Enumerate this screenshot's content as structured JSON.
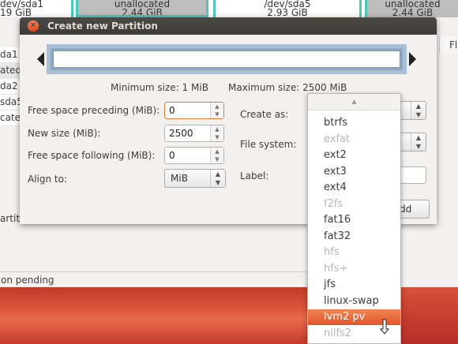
{
  "background_window": {
    "top_cells": [
      {
        "line1": "dev/sda1",
        "line2": "19 GiB"
      },
      {
        "line1": "unallocated",
        "line2": "2.44 GiB"
      },
      {
        "line1": "/dev/sda5",
        "line2": "2.93 GiB"
      },
      {
        "line1": "unallocated",
        "line2": "2.44 GiB"
      }
    ],
    "column_header": "Fl",
    "list_rows": [
      "da1",
      "ated",
      "da2",
      "sda5",
      "cate"
    ],
    "partitions_label": "artiti",
    "pending_status": "on pending"
  },
  "dialog": {
    "title": "Create new Partition",
    "close_glyph": "✕",
    "min_size": "Minimum size: 1 MiB",
    "max_size": "Maximum size: 2500 MiB",
    "fields": {
      "free_before_label": "Free space preceding (MiB):",
      "free_before_value": "0",
      "new_size_label": "New size (MiB):",
      "new_size_value": "2500",
      "free_after_label": "Free space following (MiB):",
      "free_after_value": "0",
      "align_label": "Align to:",
      "align_value": "MiB",
      "create_as_label": "Create as:",
      "filesystem_label": "File system:",
      "label_label": "Label:"
    },
    "add_button_partial": "dd"
  },
  "dropdown": {
    "scroll_up_glyph": "▲",
    "options": [
      {
        "label": "btrfs",
        "enabled": true
      },
      {
        "label": "exfat",
        "enabled": false
      },
      {
        "label": "ext2",
        "enabled": true
      },
      {
        "label": "ext3",
        "enabled": true
      },
      {
        "label": "ext4",
        "enabled": true
      },
      {
        "label": "f2fs",
        "enabled": false
      },
      {
        "label": "fat16",
        "enabled": true
      },
      {
        "label": "fat32",
        "enabled": true
      },
      {
        "label": "hfs",
        "enabled": false
      },
      {
        "label": "hfs+",
        "enabled": false
      },
      {
        "label": "jfs",
        "enabled": true
      },
      {
        "label": "linux-swap",
        "enabled": true
      },
      {
        "label": "lvm2 pv",
        "enabled": true,
        "highlighted": true
      },
      {
        "label": "nilfs2",
        "enabled": false
      }
    ]
  },
  "colors": {
    "accent": "#e0562a",
    "titlebar": "#3c3b37",
    "partition_border": "#4fc7b8",
    "desktop": "#c63a2c"
  }
}
